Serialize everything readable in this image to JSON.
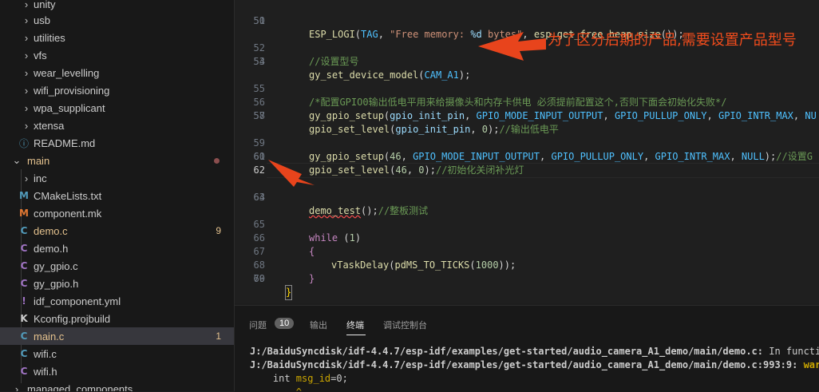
{
  "sidebar": {
    "items": [
      {
        "label": "unity",
        "type": "folder",
        "collapsed": true
      },
      {
        "label": "usb",
        "type": "folder",
        "collapsed": true
      },
      {
        "label": "utilities",
        "type": "folder",
        "collapsed": true
      },
      {
        "label": "vfs",
        "type": "folder",
        "collapsed": true
      },
      {
        "label": "wear_levelling",
        "type": "folder",
        "collapsed": true
      },
      {
        "label": "wifi_provisioning",
        "type": "folder",
        "collapsed": true
      },
      {
        "label": "wpa_supplicant",
        "type": "folder",
        "collapsed": true
      },
      {
        "label": "xtensa",
        "type": "folder",
        "collapsed": true
      },
      {
        "label": "README.md",
        "type": "file",
        "icon": "info-icon"
      },
      {
        "label": "main",
        "type": "folder",
        "collapsed": false
      },
      {
        "label": "inc",
        "type": "folder",
        "collapsed": true
      },
      {
        "label": "CMakeLists.txt",
        "type": "file",
        "icon": "cmake-icon"
      },
      {
        "label": "component.mk",
        "type": "file",
        "icon": "makefile-icon"
      },
      {
        "label": "demo.c",
        "type": "file",
        "icon": "c-file-icon",
        "badge": "9"
      },
      {
        "label": "demo.h",
        "type": "file",
        "icon": "c-header-icon"
      },
      {
        "label": "gy_gpio.c",
        "type": "file",
        "icon": "c-file-icon"
      },
      {
        "label": "gy_gpio.h",
        "type": "file",
        "icon": "c-header-icon"
      },
      {
        "label": "idf_component.yml",
        "type": "file",
        "icon": "yaml-icon"
      },
      {
        "label": "Kconfig.projbuild",
        "type": "file",
        "icon": "kconfig-icon"
      },
      {
        "label": "main.c",
        "type": "file",
        "icon": "c-file-icon",
        "badge": "1"
      },
      {
        "label": "wifi.c",
        "type": "file",
        "icon": "c-file-icon"
      },
      {
        "label": "wifi.h",
        "type": "file",
        "icon": "c-header-icon"
      },
      {
        "label": "managed_components",
        "type": "folder",
        "collapsed": true
      }
    ]
  },
  "editor": {
    "lines": [
      {
        "n": "50",
        "code": "ESP_LOGI(TAG, \"Free memory: %d bytes\", esp_get_free_heap_size());"
      },
      {
        "n": "51",
        "code": ""
      },
      {
        "n": "52",
        "code": "//设置型号"
      },
      {
        "n": "53",
        "code": "gy_set_device_model(CAM_A1);"
      },
      {
        "n": "54",
        "code": ""
      },
      {
        "n": "55",
        "code": "/*配置GPIO0输出低电平用来给摄像头和内存卡供电 必须提前配置这个,否则下面会初始化失败*/"
      },
      {
        "n": "56",
        "code": "gy_gpio_setup(gpio_init_pin, GPIO_MODE_INPUT_OUTPUT, GPIO_PULLUP_ONLY, GPIO_INTR_MAX, NU"
      },
      {
        "n": "57",
        "code": "gpio_set_level(gpio_init_pin, 0);//输出低电平"
      },
      {
        "n": "58",
        "code": ""
      },
      {
        "n": "59",
        "code": "gy_gpio_setup(46, GPIO_MODE_INPUT_OUTPUT, GPIO_PULLUP_ONLY, GPIO_INTR_MAX, NULL);//设置G"
      },
      {
        "n": "60",
        "code": "gpio_set_level(46, 0);//初始化关闭补光灯"
      },
      {
        "n": "61",
        "code": ""
      },
      {
        "n": "62",
        "code": ""
      },
      {
        "n": "63",
        "code": "demo_test();//整板测试"
      },
      {
        "n": "64",
        "code": ""
      },
      {
        "n": "65",
        "code": "while (1)"
      },
      {
        "n": "66",
        "code": "{"
      },
      {
        "n": "67",
        "code": "vTaskDelay(pdMS_TO_TICKS(1000));"
      },
      {
        "n": "68",
        "code": "}"
      },
      {
        "n": "69",
        "code": "}"
      },
      {
        "n": "70",
        "code": ""
      }
    ],
    "annotation": "为了区分后期的产品,需要设置产品型号"
  },
  "panel": {
    "tabs": [
      {
        "label": "问题",
        "badge": "10"
      },
      {
        "label": "输出"
      },
      {
        "label": "终端",
        "active": true
      },
      {
        "label": "调试控制台"
      }
    ],
    "terminal": {
      "line1_path": "J:/BaiduSyncdisk/idf-4.4.7/esp-idf/examples/get-started/audio_camera_A1_demo/main/demo.c:",
      "line1_rest": " In function",
      "line2_path": "J:/BaiduSyncdisk/idf-4.4.7/esp-idf/examples/get-started/audio_camera_A1_demo/main/demo.c:993:9:",
      "line2_rest": " warnin",
      "line3_pre": "    int ",
      "line3_var": "msg_id",
      "line3_post": "=0;",
      "line4": "        ^"
    }
  },
  "colors": {
    "annotation": "#f14c1c",
    "accent": "#e7e7e7",
    "modified": "#e2c08d"
  }
}
